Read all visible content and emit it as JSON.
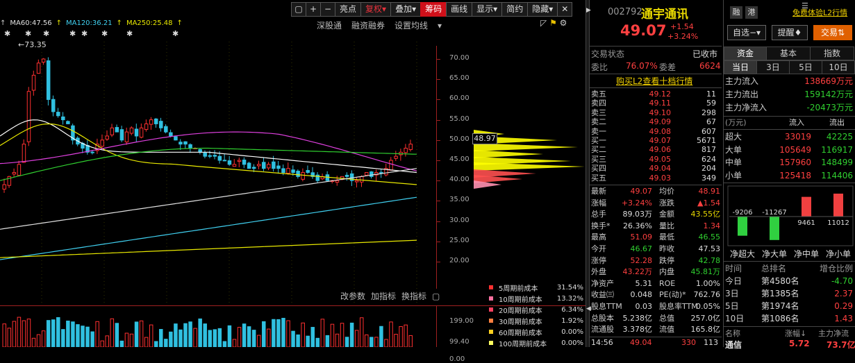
{
  "toolbar": {
    "icon1": "▢",
    "plus": "+",
    "minus": "−",
    "items": [
      "亮点",
      "复权",
      "叠加",
      "筹码",
      "画线",
      "显示",
      "简约",
      "隐藏"
    ],
    "close": "✕",
    "restore": "❐"
  },
  "ma": {
    "ma60": "MA60:47.56",
    "ma120": "MA120:36.21",
    "ma250": "MA250:25.48"
  },
  "tools1": {
    "a": "深股通",
    "b": "融资融券",
    "c": "设置均线"
  },
  "peak_label": "73.35",
  "price_ticks": [
    "70.00",
    "65.00",
    "60.00",
    "55.00",
    "50.00",
    "45.00",
    "40.00",
    "35.00",
    "30.00",
    "25.00",
    "20.00"
  ],
  "current_price_tag": "48.97",
  "tools2": {
    "a": "改参数",
    "b": "加指标",
    "c": "换指标"
  },
  "vol_ticks": [
    "199.00",
    "99.40",
    "0.00"
  ],
  "cost": [
    {
      "label": "5周期前成本",
      "value": "31.54%",
      "color": "#ff3030"
    },
    {
      "label": "10周期前成本",
      "value": "13.32%",
      "color": "#ff70a0"
    },
    {
      "label": "20周期前成本",
      "value": "6.34%",
      "color": "#ff4060"
    },
    {
      "label": "30周期前成本",
      "value": "1.92%",
      "color": "#ff8040"
    },
    {
      "label": "60周期前成本",
      "value": "0.00%",
      "color": "#ffd020"
    },
    {
      "label": "100周期前成本",
      "value": "0.00%",
      "color": "#ffff60"
    }
  ],
  "stock": {
    "code": "002792",
    "name": "通宇通讯",
    "tag1": "融",
    "tag2": "港",
    "trial": "免费体验L2行情",
    "price": "49.07",
    "change": "+1.54",
    "pct": "+3.24%",
    "select": "自选",
    "remind": "提醒",
    "trade": "交易"
  },
  "status": {
    "label": "交易状态",
    "value": "已收市",
    "wb_label": "委比",
    "wb": "76.07%",
    "wc_label": "委差",
    "wc": "6624",
    "l2": "购买L2查看十档行情"
  },
  "orderbook": [
    {
      "label": "卖五",
      "price": "49.12",
      "vol": "11"
    },
    {
      "label": "卖四",
      "price": "49.11",
      "vol": "59"
    },
    {
      "label": "卖三",
      "price": "49.10",
      "vol": "298"
    },
    {
      "label": "卖二",
      "price": "49.09",
      "vol": "67"
    },
    {
      "label": "卖一",
      "price": "49.08",
      "vol": "607"
    },
    {
      "label": "买一",
      "price": "49.07",
      "vol": "5671"
    },
    {
      "label": "买二",
      "price": "49.06",
      "vol": "817"
    },
    {
      "label": "买三",
      "price": "49.05",
      "vol": "624"
    },
    {
      "label": "买四",
      "price": "49.04",
      "vol": "204"
    },
    {
      "label": "买五",
      "price": "49.03",
      "vol": "349"
    }
  ],
  "stats": [
    [
      "最新",
      "49.07",
      "red",
      "均价",
      "48.91",
      "red"
    ],
    [
      "涨幅",
      "+3.24%",
      "red",
      "涨跌",
      "▲1.54",
      "red"
    ],
    [
      "总手",
      "89.03万",
      "wht",
      "金额",
      "43.55亿",
      "yel"
    ],
    [
      "换手*",
      "26.36%",
      "wht",
      "量比",
      "1.34",
      "red"
    ],
    [
      "最高",
      "51.09",
      "red",
      "最低",
      "46.55",
      "grn"
    ],
    [
      "今开",
      "46.67",
      "grn",
      "昨收",
      "47.53",
      "wht"
    ],
    [
      "涨停",
      "52.28",
      "red",
      "跌停",
      "42.78",
      "grn"
    ],
    [
      "外盘",
      "43.22万",
      "red",
      "内盘",
      "45.81万",
      "grn"
    ],
    [
      "净资产",
      "5.31",
      "wht",
      "ROE",
      "1.00%",
      "wht"
    ],
    [
      "收益㈢",
      "0.048",
      "wht",
      "PE(动)*",
      "762.76",
      "wht"
    ],
    [
      "股息TTM",
      "0.03",
      "wht",
      "股息率TTM",
      "0.05%",
      "wht"
    ],
    [
      "总股本",
      "5.238亿",
      "wht",
      "总值",
      "257.0亿",
      "wht"
    ],
    [
      "流通股",
      "3.378亿",
      "wht",
      "流值",
      "165.8亿",
      "wht"
    ]
  ],
  "tick": {
    "time": "14:56",
    "price": "49.04",
    "vol": "330",
    "num": "113"
  },
  "info": {
    "tabs": [
      "资金",
      "基本",
      "指数"
    ],
    "subtabs": [
      "当日",
      "3日",
      "5日",
      "10日"
    ],
    "flows": [
      [
        "主力流入",
        "138669万元",
        "red"
      ],
      [
        "主力流出",
        "159142万元",
        "grn"
      ],
      [
        "主力净流入",
        "-20473万元",
        "grn"
      ]
    ],
    "unit": "(万元)",
    "in": "流入",
    "out": "流出",
    "sizes": [
      [
        "超大",
        "33019",
        "42225"
      ],
      [
        "大单",
        "105649",
        "116917"
      ],
      [
        "中单",
        "157960",
        "148499"
      ],
      [
        "小单",
        "125418",
        "114406"
      ]
    ],
    "bar_labels": [
      "净超大",
      "净大单",
      "净中单",
      "净小单"
    ],
    "bar_values": [
      "-9206",
      "-11267",
      "9461",
      "11012"
    ],
    "rank_hdr": [
      "时间",
      "总排名",
      "增仓比例"
    ],
    "ranks": [
      [
        "今日",
        "第4580名",
        "-4.70",
        "grn"
      ],
      [
        "3日",
        "第1385名",
        "2.37",
        "red"
      ],
      [
        "5日",
        "第1974名",
        "0.29",
        "red"
      ],
      [
        "10日",
        "第1086名",
        "1.43",
        "red"
      ]
    ],
    "bottom_hdr": [
      "名称",
      "涨幅↓",
      "主力净流"
    ],
    "bottom_row": [
      "通信",
      "5.72",
      "73.7亿"
    ]
  }
}
